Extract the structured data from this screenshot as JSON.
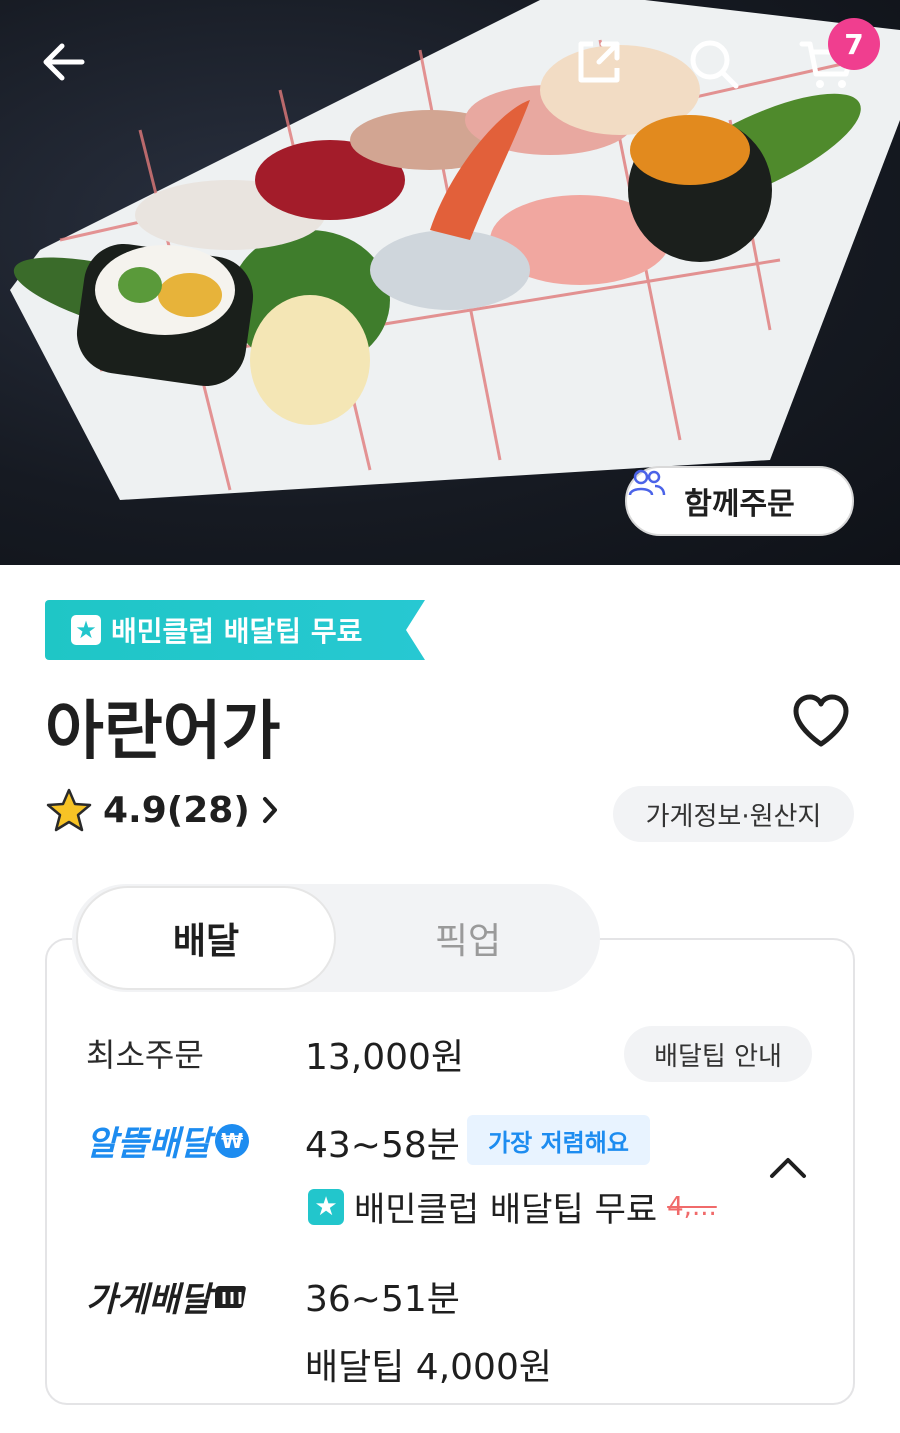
{
  "header": {
    "cart_count": "7",
    "group_order_label": "함께주문"
  },
  "club_tag": {
    "label": "배민클럽 배달팁 무료"
  },
  "store": {
    "name": "아란어가",
    "rating": "4.9(28)",
    "info_button": "가게정보·원산지"
  },
  "tabs": [
    {
      "label": "배달",
      "active": true
    },
    {
      "label": "픽업",
      "active": false
    }
  ],
  "delivery": {
    "min_order_label": "최소주문",
    "min_order_value": "13,000원",
    "tip_guide_label": "배달팁 안내",
    "saver": {
      "label": "알뜰배달",
      "time": "43~58분",
      "badge": "가장 저렴해요",
      "club_text": "배민클럽 배달팁 무료",
      "original_fee": "4,..."
    },
    "store_delivery": {
      "label": "가게배달",
      "time": "36~51분",
      "fee": "배달팁 4,000원"
    }
  },
  "colors": {
    "accent_blue": "#1d8cf0",
    "club_teal": "#22c6cc",
    "badge_pink": "#f03e8f"
  }
}
